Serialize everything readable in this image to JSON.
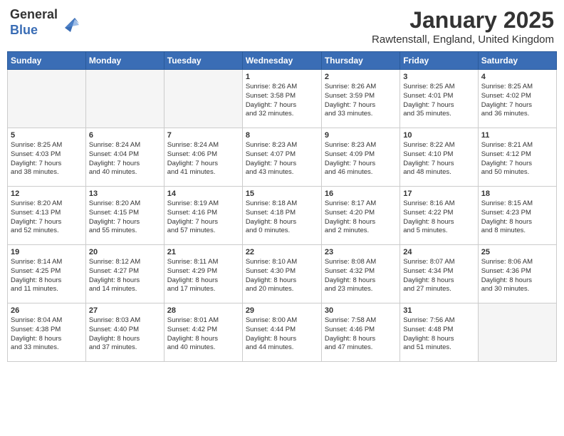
{
  "header": {
    "logo_general": "General",
    "logo_blue": "Blue",
    "title": "January 2025",
    "location": "Rawtenstall, England, United Kingdom"
  },
  "weekdays": [
    "Sunday",
    "Monday",
    "Tuesday",
    "Wednesday",
    "Thursday",
    "Friday",
    "Saturday"
  ],
  "weeks": [
    [
      {
        "day": "",
        "text": ""
      },
      {
        "day": "",
        "text": ""
      },
      {
        "day": "",
        "text": ""
      },
      {
        "day": "1",
        "text": "Sunrise: 8:26 AM\nSunset: 3:58 PM\nDaylight: 7 hours\nand 32 minutes."
      },
      {
        "day": "2",
        "text": "Sunrise: 8:26 AM\nSunset: 3:59 PM\nDaylight: 7 hours\nand 33 minutes."
      },
      {
        "day": "3",
        "text": "Sunrise: 8:25 AM\nSunset: 4:01 PM\nDaylight: 7 hours\nand 35 minutes."
      },
      {
        "day": "4",
        "text": "Sunrise: 8:25 AM\nSunset: 4:02 PM\nDaylight: 7 hours\nand 36 minutes."
      }
    ],
    [
      {
        "day": "5",
        "text": "Sunrise: 8:25 AM\nSunset: 4:03 PM\nDaylight: 7 hours\nand 38 minutes."
      },
      {
        "day": "6",
        "text": "Sunrise: 8:24 AM\nSunset: 4:04 PM\nDaylight: 7 hours\nand 40 minutes."
      },
      {
        "day": "7",
        "text": "Sunrise: 8:24 AM\nSunset: 4:06 PM\nDaylight: 7 hours\nand 41 minutes."
      },
      {
        "day": "8",
        "text": "Sunrise: 8:23 AM\nSunset: 4:07 PM\nDaylight: 7 hours\nand 43 minutes."
      },
      {
        "day": "9",
        "text": "Sunrise: 8:23 AM\nSunset: 4:09 PM\nDaylight: 7 hours\nand 46 minutes."
      },
      {
        "day": "10",
        "text": "Sunrise: 8:22 AM\nSunset: 4:10 PM\nDaylight: 7 hours\nand 48 minutes."
      },
      {
        "day": "11",
        "text": "Sunrise: 8:21 AM\nSunset: 4:12 PM\nDaylight: 7 hours\nand 50 minutes."
      }
    ],
    [
      {
        "day": "12",
        "text": "Sunrise: 8:20 AM\nSunset: 4:13 PM\nDaylight: 7 hours\nand 52 minutes."
      },
      {
        "day": "13",
        "text": "Sunrise: 8:20 AM\nSunset: 4:15 PM\nDaylight: 7 hours\nand 55 minutes."
      },
      {
        "day": "14",
        "text": "Sunrise: 8:19 AM\nSunset: 4:16 PM\nDaylight: 7 hours\nand 57 minutes."
      },
      {
        "day": "15",
        "text": "Sunrise: 8:18 AM\nSunset: 4:18 PM\nDaylight: 8 hours\nand 0 minutes."
      },
      {
        "day": "16",
        "text": "Sunrise: 8:17 AM\nSunset: 4:20 PM\nDaylight: 8 hours\nand 2 minutes."
      },
      {
        "day": "17",
        "text": "Sunrise: 8:16 AM\nSunset: 4:22 PM\nDaylight: 8 hours\nand 5 minutes."
      },
      {
        "day": "18",
        "text": "Sunrise: 8:15 AM\nSunset: 4:23 PM\nDaylight: 8 hours\nand 8 minutes."
      }
    ],
    [
      {
        "day": "19",
        "text": "Sunrise: 8:14 AM\nSunset: 4:25 PM\nDaylight: 8 hours\nand 11 minutes."
      },
      {
        "day": "20",
        "text": "Sunrise: 8:12 AM\nSunset: 4:27 PM\nDaylight: 8 hours\nand 14 minutes."
      },
      {
        "day": "21",
        "text": "Sunrise: 8:11 AM\nSunset: 4:29 PM\nDaylight: 8 hours\nand 17 minutes."
      },
      {
        "day": "22",
        "text": "Sunrise: 8:10 AM\nSunset: 4:30 PM\nDaylight: 8 hours\nand 20 minutes."
      },
      {
        "day": "23",
        "text": "Sunrise: 8:08 AM\nSunset: 4:32 PM\nDaylight: 8 hours\nand 23 minutes."
      },
      {
        "day": "24",
        "text": "Sunrise: 8:07 AM\nSunset: 4:34 PM\nDaylight: 8 hours\nand 27 minutes."
      },
      {
        "day": "25",
        "text": "Sunrise: 8:06 AM\nSunset: 4:36 PM\nDaylight: 8 hours\nand 30 minutes."
      }
    ],
    [
      {
        "day": "26",
        "text": "Sunrise: 8:04 AM\nSunset: 4:38 PM\nDaylight: 8 hours\nand 33 minutes."
      },
      {
        "day": "27",
        "text": "Sunrise: 8:03 AM\nSunset: 4:40 PM\nDaylight: 8 hours\nand 37 minutes."
      },
      {
        "day": "28",
        "text": "Sunrise: 8:01 AM\nSunset: 4:42 PM\nDaylight: 8 hours\nand 40 minutes."
      },
      {
        "day": "29",
        "text": "Sunrise: 8:00 AM\nSunset: 4:44 PM\nDaylight: 8 hours\nand 44 minutes."
      },
      {
        "day": "30",
        "text": "Sunrise: 7:58 AM\nSunset: 4:46 PM\nDaylight: 8 hours\nand 47 minutes."
      },
      {
        "day": "31",
        "text": "Sunrise: 7:56 AM\nSunset: 4:48 PM\nDaylight: 8 hours\nand 51 minutes."
      },
      {
        "day": "",
        "text": ""
      }
    ]
  ]
}
